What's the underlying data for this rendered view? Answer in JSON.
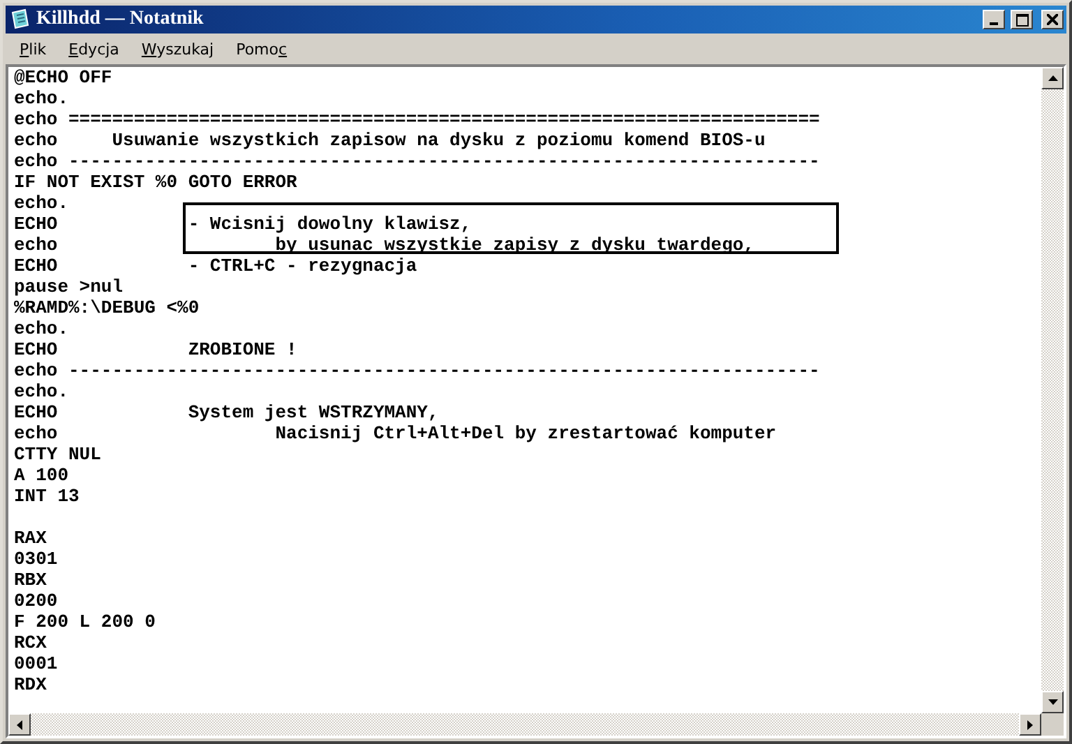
{
  "window": {
    "title": "Killhdd — Notatnik"
  },
  "menu": [
    {
      "key": "P",
      "post": "lik"
    },
    {
      "key": "E",
      "post": "dycja"
    },
    {
      "key": "W",
      "post": "yszukaj"
    },
    {
      "pre": "Pomo",
      "key": "c"
    }
  ],
  "editor": {
    "lines": [
      {
        "kind": "text",
        "text": "@ECHO OFF"
      },
      {
        "kind": "text",
        "text": "echo."
      },
      {
        "kind": "text",
        "text": "echo ====================================================================="
      },
      {
        "kind": "text",
        "text": "echo     Usuwanie wszystkich zapisow na dysku z poziomu komend BIOS-u"
      },
      {
        "kind": "text",
        "text": "echo ---------------------------------------------------------------------"
      },
      {
        "kind": "text",
        "text": "IF NOT EXIST %0 GOTO ERROR"
      },
      {
        "kind": "text",
        "text": "echo."
      },
      {
        "kind": "text",
        "text": "ECHO            - Wcisnij dowolny klawisz,"
      },
      {
        "kind": "text",
        "text": "echo                    by usunac wszystkie zapisy z dysku twardego,"
      },
      {
        "kind": "text",
        "text": "ECHO            - CTRL+C - rezygnacja"
      },
      {
        "kind": "text",
        "text": "pause >nul"
      },
      {
        "kind": "text",
        "text": "%RAMD%:\\DEBUG <%0"
      },
      {
        "kind": "text",
        "text": "echo."
      },
      {
        "kind": "text",
        "text": "ECHO            ZROBIONE !"
      },
      {
        "kind": "text",
        "text": "echo ---------------------------------------------------------------------"
      },
      {
        "kind": "text",
        "text": "echo."
      },
      {
        "kind": "text",
        "text": "ECHO            System jest WSTRZYMANY,"
      },
      {
        "kind": "text",
        "text": "echo                    Nacisnij Ctrl+Alt+Del by zrestartować komputer"
      },
      {
        "kind": "text",
        "text": "CTTY NUL"
      },
      {
        "kind": "text",
        "text": "A 100"
      },
      {
        "kind": "text",
        "text": "INT 13"
      },
      {
        "kind": "blank"
      },
      {
        "kind": "text",
        "text": "RAX"
      },
      {
        "kind": "text",
        "text": "0301"
      },
      {
        "kind": "text",
        "text": "RBX"
      },
      {
        "kind": "text",
        "text": "0200"
      },
      {
        "kind": "text",
        "text": "F 200 L 200 0"
      },
      {
        "kind": "text",
        "text": "RCX"
      },
      {
        "kind": "text",
        "text": "0001"
      },
      {
        "kind": "text",
        "text": "RDX"
      }
    ]
  }
}
